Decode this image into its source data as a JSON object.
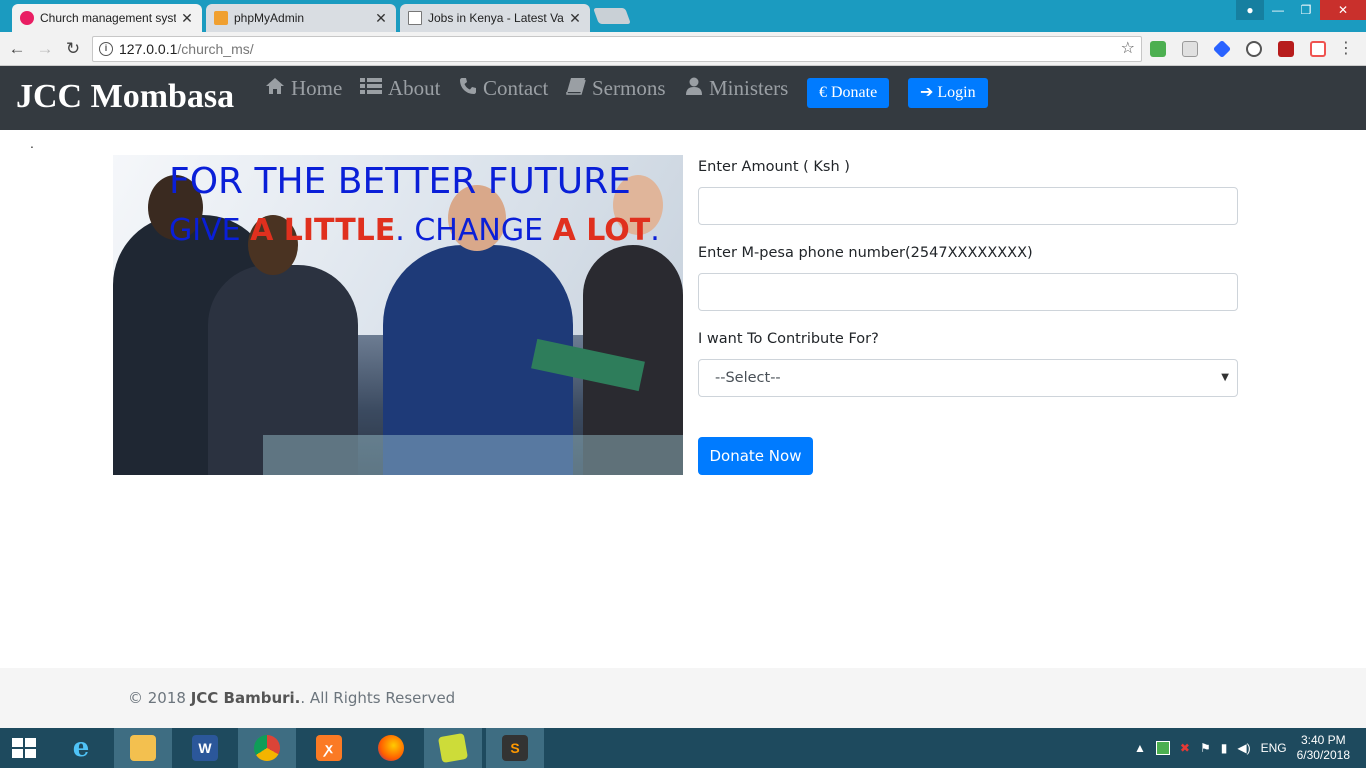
{
  "browser": {
    "tabs": [
      {
        "title": "Church management syst",
        "active": true
      },
      {
        "title": "phpMyAdmin",
        "active": false
      },
      {
        "title": "Jobs in Kenya - Latest Va",
        "active": false
      }
    ],
    "url_host": "127.0.0.1",
    "url_path": "/church_ms/"
  },
  "navbar": {
    "brand": "JCC Mombasa",
    "links": [
      {
        "label": "Home",
        "icon": "home-icon"
      },
      {
        "label": "About",
        "icon": "list-icon"
      },
      {
        "label": "Contact",
        "icon": "phone-icon"
      },
      {
        "label": "Sermons",
        "icon": "book-icon"
      },
      {
        "label": "Ministers",
        "icon": "user-icon"
      }
    ],
    "donate_label": "Donate",
    "login_label": "Login"
  },
  "page": {
    "stray_dot": "."
  },
  "banner": {
    "line1": "FOR THE BETTER FUTURE",
    "line2_part1": "GIVE ",
    "line2_red1": "A LITTLE",
    "line2_part2": ". CHANGE ",
    "line2_red2": "A LOT",
    "line2_part3": "."
  },
  "form": {
    "amount_label": "Enter Amount ( Ksh )",
    "amount_value": "",
    "phone_label": "Enter M-pesa phone number(2547XXXXXXXX)",
    "phone_value": "",
    "purpose_label": "I want To Contribute For?",
    "purpose_selected": "--Select--",
    "submit_label": "Donate Now"
  },
  "footer": {
    "prefix": "© 2018 ",
    "org": "JCC Bamburi.",
    "suffix": ". All Rights Reserved"
  },
  "taskbar": {
    "language": "ENG",
    "time": "3:40 PM",
    "date": "6/30/2018"
  },
  "colors": {
    "navbar_bg": "#343a40",
    "primary": "#007bff",
    "banner_blue": "#0a1fd8",
    "banner_red": "#e0301e"
  }
}
